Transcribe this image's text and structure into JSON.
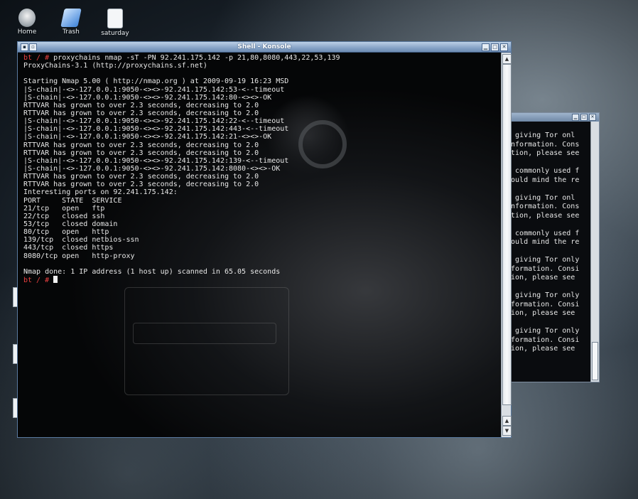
{
  "desktop": {
    "icons": [
      {
        "label": "Home"
      },
      {
        "label": "Trash"
      },
      {
        "label": "saturday"
      }
    ]
  },
  "main_window": {
    "title": "Shell - Konsole",
    "lines": [
      {
        "prompt": "bt / # ",
        "text": "proxychains nmap -sT -PN 92.241.175.142 -p 21,80,8080,443,22,53,139"
      },
      {
        "prompt": "",
        "text": "ProxyChains-3.1 (http://proxychains.sf.net)"
      },
      {
        "prompt": "",
        "text": ""
      },
      {
        "prompt": "",
        "text": "Starting Nmap 5.00 ( http://nmap.org ) at 2009-09-19 16:23 MSD"
      },
      {
        "prompt": "",
        "text": "|S-chain|-<>-127.0.0.1:9050-<><>-92.241.175.142:53-<--timeout"
      },
      {
        "prompt": "",
        "text": "|S-chain|-<>-127.0.0.1:9050-<><>-92.241.175.142:80-<><>-OK"
      },
      {
        "prompt": "",
        "text": "RTTVAR has grown to over 2.3 seconds, decreasing to 2.0"
      },
      {
        "prompt": "",
        "text": "RTTVAR has grown to over 2.3 seconds, decreasing to 2.0"
      },
      {
        "prompt": "",
        "text": "|S-chain|-<>-127.0.0.1:9050-<><>-92.241.175.142:22-<--timeout"
      },
      {
        "prompt": "",
        "text": "|S-chain|-<>-127.0.0.1:9050-<><>-92.241.175.142:443-<--timeout"
      },
      {
        "prompt": "",
        "text": "|S-chain|-<>-127.0.0.1:9050-<><>-92.241.175.142:21-<><>-OK"
      },
      {
        "prompt": "",
        "text": "RTTVAR has grown to over 2.3 seconds, decreasing to 2.0"
      },
      {
        "prompt": "",
        "text": "RTTVAR has grown to over 2.3 seconds, decreasing to 2.0"
      },
      {
        "prompt": "",
        "text": "|S-chain|-<>-127.0.0.1:9050-<><>-92.241.175.142:139-<--timeout"
      },
      {
        "prompt": "",
        "text": "|S-chain|-<>-127.0.0.1:9050-<><>-92.241.175.142:8080-<><>-OK"
      },
      {
        "prompt": "",
        "text": "RTTVAR has grown to over 2.3 seconds, decreasing to 2.0"
      },
      {
        "prompt": "",
        "text": "RTTVAR has grown to over 2.3 seconds, decreasing to 2.0"
      },
      {
        "prompt": "",
        "text": "Interesting ports on 92.241.175.142:"
      },
      {
        "prompt": "",
        "text": "PORT     STATE  SERVICE"
      },
      {
        "prompt": "",
        "text": "21/tcp   open   ftp"
      },
      {
        "prompt": "",
        "text": "22/tcp   closed ssh"
      },
      {
        "prompt": "",
        "text": "53/tcp   closed domain"
      },
      {
        "prompt": "",
        "text": "80/tcp   open   http"
      },
      {
        "prompt": "",
        "text": "139/tcp  closed netbios-ssn"
      },
      {
        "prompt": "",
        "text": "443/tcp  closed https"
      },
      {
        "prompt": "",
        "text": "8080/tcp open   http-proxy"
      },
      {
        "prompt": "",
        "text": ""
      },
      {
        "prompt": "",
        "text": "Nmap done: 1 IP address (1 host up) scanned in 65.05 seconds"
      },
      {
        "prompt": "bt / # ",
        "text": ""
      }
    ]
  },
  "back_window": {
    "lines": [
      "s giving Tor onl",
      "information. Cons",
      "ation, please see",
      "",
      "s commonly used f",
      "would mind the re",
      "",
      "s giving Tor onl",
      "information. Cons",
      "ation, please see",
      "",
      "s commonly used f",
      "would mind the re",
      "",
      "s giving Tor only",
      "nformation. Consi",
      "tion, please see",
      "",
      "s giving Tor only",
      "nformation. Consi",
      "tion, please see",
      "",
      "s giving Tor only",
      "nformation. Consi",
      "tion, please see"
    ]
  },
  "colors": {
    "prompt": "#e84040",
    "terminal_text": "#e8e8e8",
    "titlebar": "#86a3c6"
  }
}
